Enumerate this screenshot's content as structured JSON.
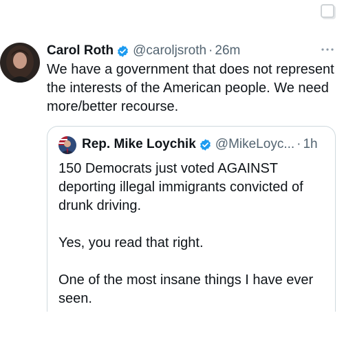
{
  "tweet": {
    "author_name": "Carol Roth",
    "handle": "@caroljsroth",
    "separator": "·",
    "time": "26m",
    "text": "We have a government that does not represent the interests of the American people. We need more/better recourse.",
    "more_icon": "more-horizontal-icon"
  },
  "quote": {
    "author_name": "Rep. Mike Loychik",
    "handle": "@MikeLoyc...",
    "separator": "·",
    "time": "1h",
    "paragraphs": [
      "150 Democrats just voted AGAINST deporting illegal immigrants convicted of drunk driving.",
      "Yes, you read that right.",
      "One of the most insane things I have ever seen."
    ]
  },
  "colors": {
    "verified": "#1d9bf0",
    "secondary_text": "#536471",
    "primary_text": "#0f1419",
    "border": "#cfd9de"
  }
}
